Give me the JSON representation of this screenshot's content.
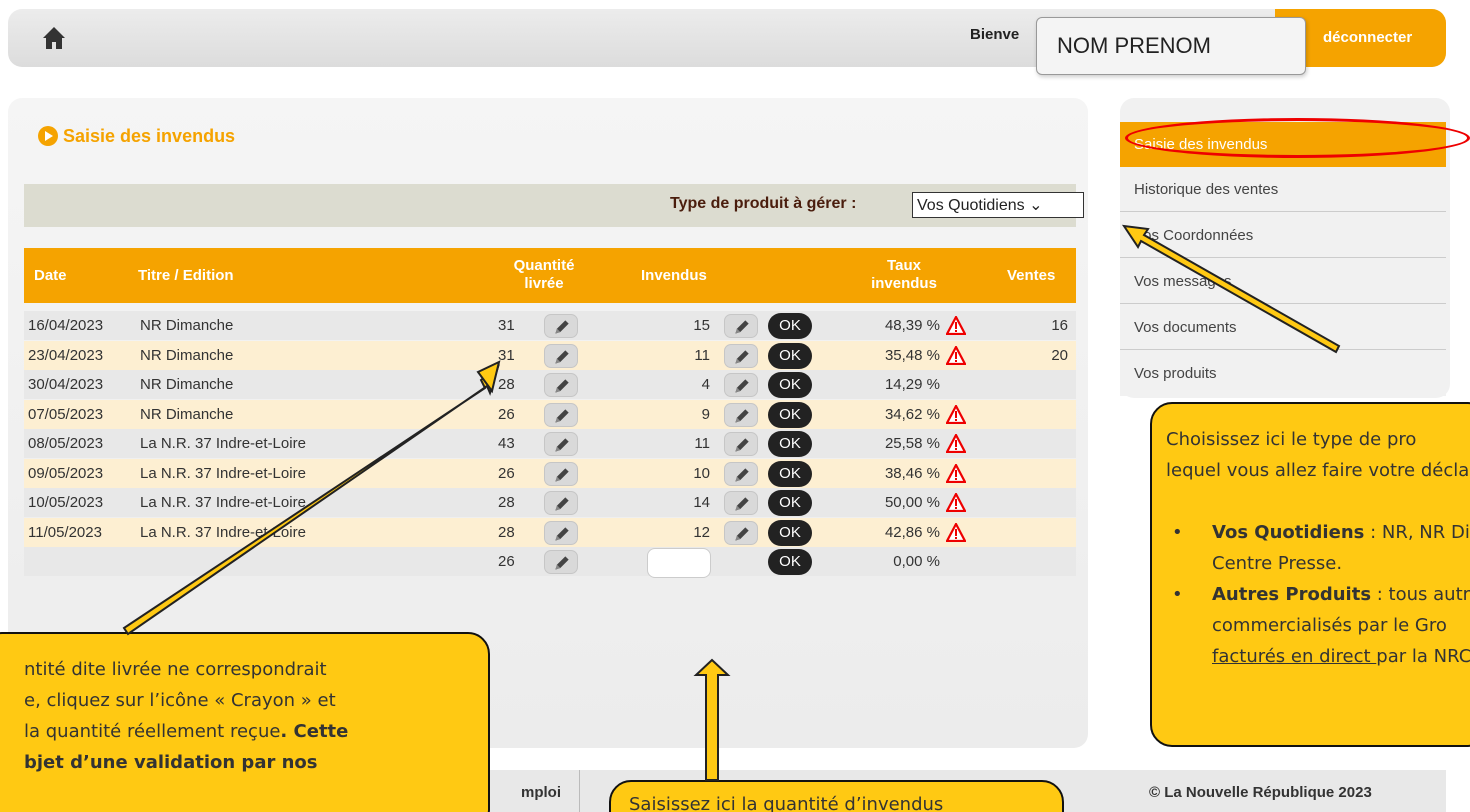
{
  "header": {
    "welcome_text": "Bienve",
    "user_name": "NOM PRENOM",
    "logout_label": "déconnecter"
  },
  "main": {
    "section_title": "Saisie des invendus",
    "filter_label": "Type de produit à gérer :",
    "filter_value": "Vos Quotidiens ⌄",
    "columns": {
      "date": "Date",
      "title": "Titre / Edition",
      "qty_line1": "Quantité",
      "qty_line2": "livrée",
      "invendus": "Invendus",
      "rate_line1": "Taux",
      "rate_line2": "invendus",
      "ventes": "Ventes"
    },
    "rows": [
      {
        "date": "16/04/2023",
        "title": "NR Dimanche",
        "qty": "31",
        "invendus": "15",
        "ok": "OK",
        "rate": "48,39 %",
        "warn": true,
        "ventes": "16"
      },
      {
        "date": "23/04/2023",
        "title": "NR Dimanche",
        "qty": "31",
        "invendus": "11",
        "ok": "OK",
        "rate": "35,48 %",
        "warn": true,
        "ventes": "20"
      },
      {
        "date": "30/04/2023",
        "title": "NR Dimanche",
        "qty": "28",
        "invendus": "4",
        "ok": "OK",
        "rate": "14,29 %",
        "warn": false,
        "ventes": ""
      },
      {
        "date": "07/05/2023",
        "title": "NR Dimanche",
        "qty": "26",
        "invendus": "9",
        "ok": "OK",
        "rate": "34,62 %",
        "warn": true,
        "ventes": ""
      },
      {
        "date": "08/05/2023",
        "title": "La N.R. 37 Indre-et-Loire",
        "qty": "43",
        "invendus": "11",
        "ok": "OK",
        "rate": "25,58 %",
        "warn": true,
        "ventes": ""
      },
      {
        "date": "09/05/2023",
        "title": "La N.R. 37 Indre-et-Loire",
        "qty": "26",
        "invendus": "10",
        "ok": "OK",
        "rate": "38,46 %",
        "warn": true,
        "ventes": ""
      },
      {
        "date": "10/05/2023",
        "title": "La N.R. 37 Indre-et-Loire",
        "qty": "28",
        "invendus": "14",
        "ok": "OK",
        "rate": "50,00 %",
        "warn": true,
        "ventes": ""
      },
      {
        "date": "11/05/2023",
        "title": "La N.R. 37 Indre-et-Loire",
        "qty": "28",
        "invendus": "12",
        "ok": "OK",
        "rate": "42,86 %",
        "warn": true,
        "ventes": ""
      },
      {
        "date": "",
        "title": "",
        "qty": "26",
        "invendus": "",
        "ok": "OK",
        "rate": "0,00 %",
        "warn": false,
        "ventes": ""
      }
    ]
  },
  "sidebar": {
    "items": [
      "Saisie des invendus",
      "Historique des ventes",
      "Vos Coordonnées",
      "Vos messages",
      "Vos documents",
      "Vos produits"
    ]
  },
  "footer": {
    "left_text": "mploi",
    "right_text": "© La Nouvelle République 2023"
  },
  "callouts": {
    "left": {
      "line1": "ntité dite livrée ne correspondrait",
      "line2": "e, cliquez sur l’icône « Crayon » et",
      "line3_normal": "la quantité réellement reçue",
      "line3_bold": ". Cette",
      "line4": "bjet d’une validation par nos"
    },
    "right": {
      "line1": "Choisissez ici le type de pro",
      "line2": "lequel vous allez faire votre décla",
      "b1_bold": "Vos Quotidiens",
      "b1_text": " : NR, NR Di",
      "b1_line2": "Centre Presse.",
      "b2_bold": "Autres Produits",
      "b2_text": " : tous autre",
      "b2_line2": "commercialisés par le Gro",
      "b2_line3_underline": "facturés en direct ",
      "b2_line3_text": "par la NRC"
    },
    "bottom": {
      "text": "Saisissez ici la quantité d’invendus"
    }
  },
  "colors": {
    "accent": "#f5a300",
    "callout": "#ffc913",
    "warning": "#e00000"
  }
}
